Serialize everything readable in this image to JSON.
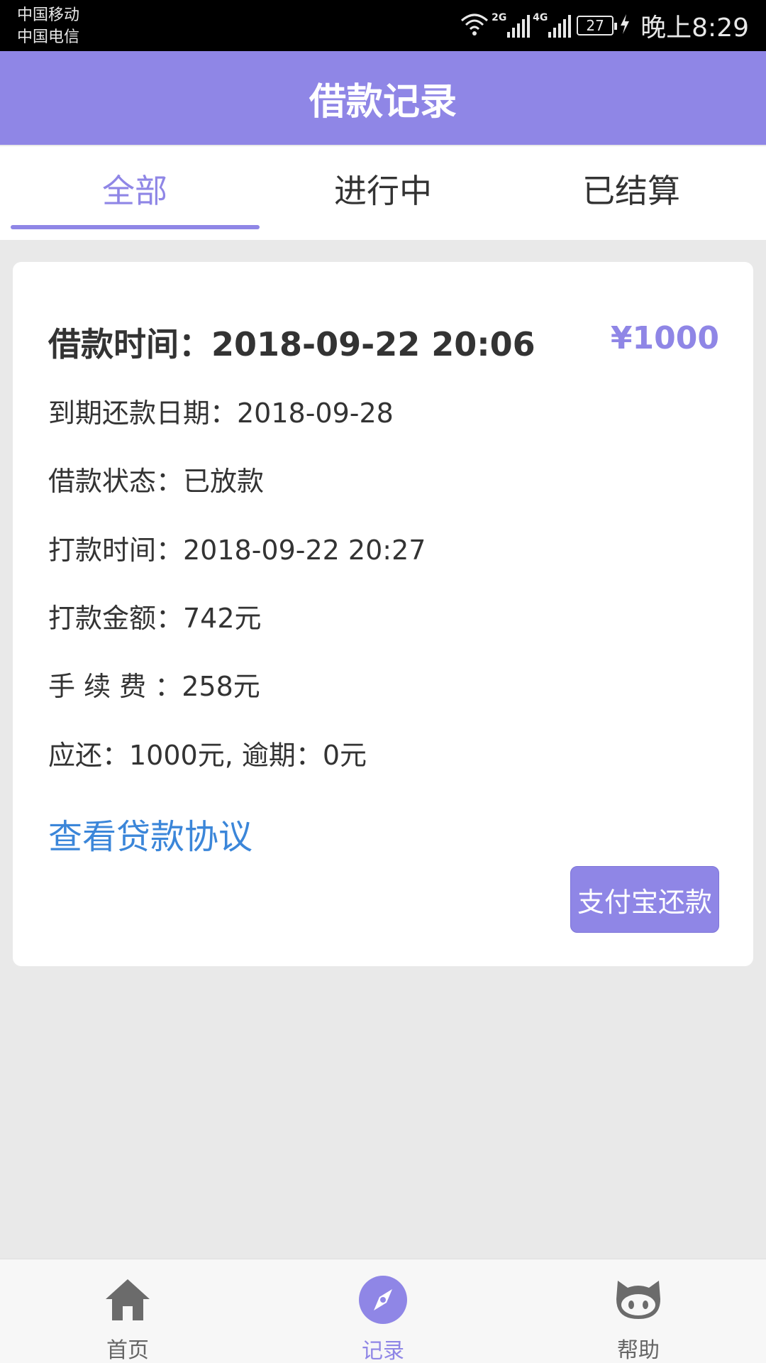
{
  "status_bar": {
    "carrier_1": "中国移动",
    "carrier_2": "中国电信",
    "network_1": "2G",
    "network_2": "4G",
    "battery": "27",
    "time": "晚上8:29"
  },
  "header": {
    "title": "借款记录"
  },
  "tabs": [
    {
      "label": "全部",
      "active": true
    },
    {
      "label": "进行中",
      "active": false
    },
    {
      "label": "已结算",
      "active": false
    }
  ],
  "record": {
    "loan_time": "借款时间：2018-09-22 20:06",
    "amount": "¥1000",
    "due_date": "到期还款日期：2018-09-28",
    "status": "借款状态：已放款",
    "payout_time": "打款时间：2018-09-22 20:27",
    "payout_amount": "打款金额：742元",
    "fee": "手 续 费 ：258元",
    "repay": "应还：1000元, 逾期：0元",
    "agreement_link": "查看贷款协议",
    "pay_button": "支付宝还款"
  },
  "bottom_nav": [
    {
      "label": "首页",
      "icon": "home-icon",
      "active": false
    },
    {
      "label": "记录",
      "icon": "compass-icon",
      "active": true
    },
    {
      "label": "帮助",
      "icon": "github-cat-icon",
      "active": false
    }
  ],
  "colors": {
    "accent": "#8f86e6",
    "link": "#3b86d9",
    "background": "#e9e9e9",
    "text": "#333333"
  }
}
